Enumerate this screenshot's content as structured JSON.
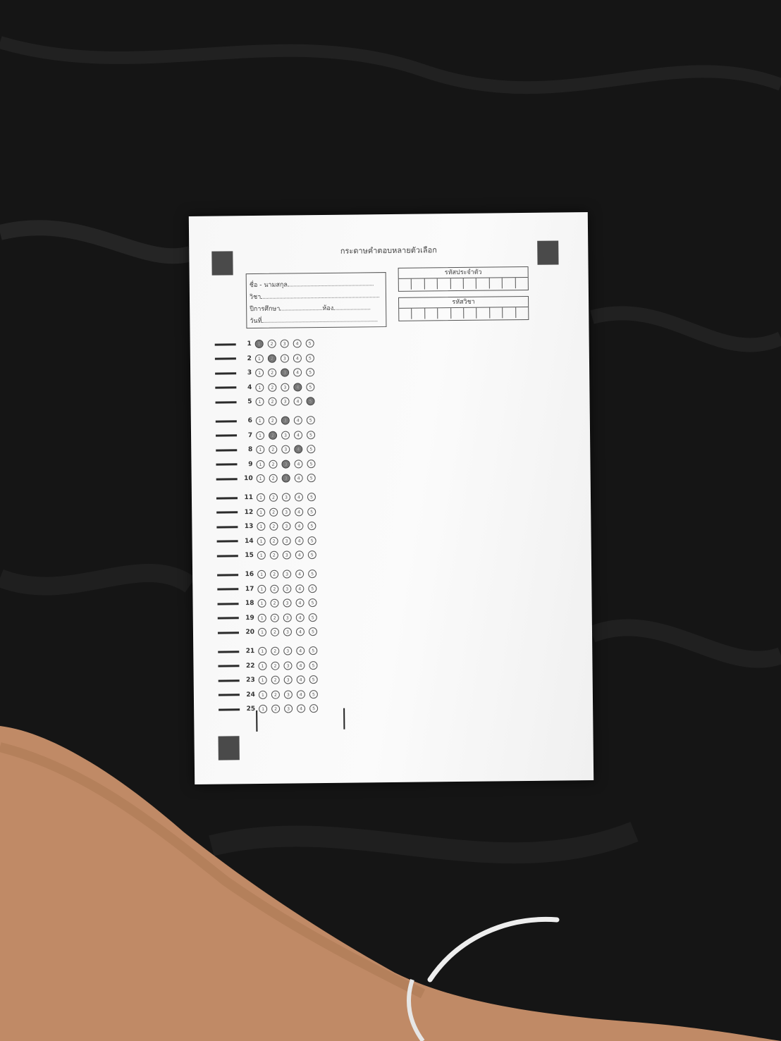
{
  "sheet": {
    "title": "กระดาษคำตอบหลายตัวเลือก",
    "info_lines": [
      {
        "label": "ชื่อ - นามสกุล"
      },
      {
        "label": "วิชา"
      },
      {
        "label": "ปีการศึกษา",
        "label2": "ห้อง"
      },
      {
        "label": "วันที่"
      }
    ],
    "student_id_label": "รหัสประจำตัว",
    "subject_code_label": "รหัสวิชา",
    "choices": [
      "1",
      "2",
      "3",
      "4",
      "5"
    ],
    "questions": [
      {
        "number": "1",
        "selected": 1
      },
      {
        "number": "2",
        "selected": 2
      },
      {
        "number": "3",
        "selected": 3
      },
      {
        "number": "4",
        "selected": 4
      },
      {
        "number": "5",
        "selected": 5
      },
      {
        "number": "6",
        "selected": 3
      },
      {
        "number": "7",
        "selected": 2
      },
      {
        "number": "8",
        "selected": 4
      },
      {
        "number": "9",
        "selected": 3
      },
      {
        "number": "10",
        "selected": 3
      },
      {
        "number": "11",
        "selected": 0
      },
      {
        "number": "12",
        "selected": 0
      },
      {
        "number": "13",
        "selected": 0
      },
      {
        "number": "14",
        "selected": 0
      },
      {
        "number": "15",
        "selected": 0
      },
      {
        "number": "16",
        "selected": 0
      },
      {
        "number": "17",
        "selected": 0
      },
      {
        "number": "18",
        "selected": 0
      },
      {
        "number": "19",
        "selected": 0
      },
      {
        "number": "20",
        "selected": 0
      },
      {
        "number": "21",
        "selected": 0
      },
      {
        "number": "22",
        "selected": 0
      },
      {
        "number": "23",
        "selected": 0
      },
      {
        "number": "24",
        "selected": 0
      },
      {
        "number": "25",
        "selected": 0
      }
    ]
  },
  "colors": {
    "background": "#141414",
    "paper": "#f7f7f7",
    "marker": "#4a4a4a",
    "fill": "#777777"
  }
}
